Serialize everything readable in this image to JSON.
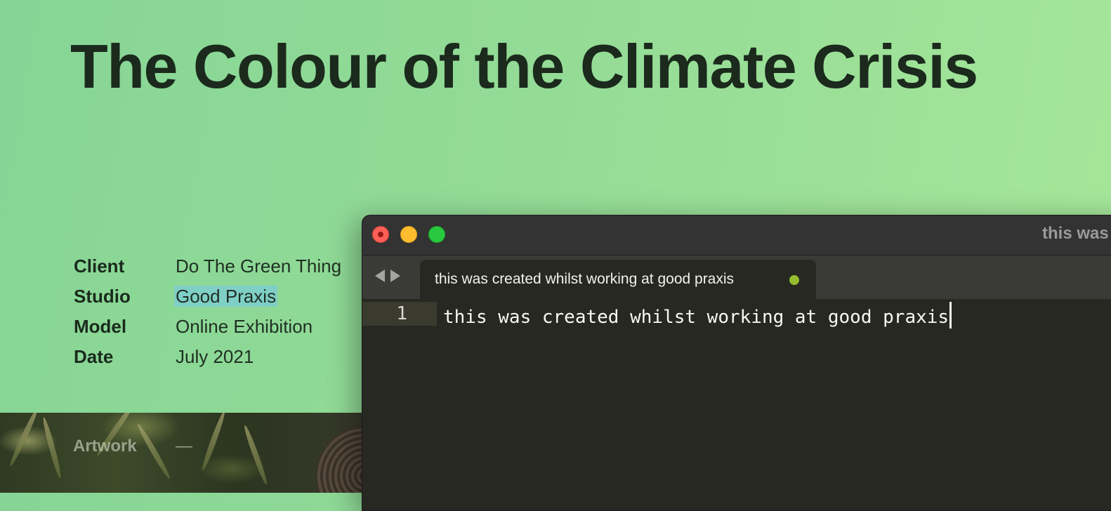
{
  "page": {
    "title": "The Colour of the Climate Crisis",
    "meta": [
      {
        "key": "Client",
        "value": "Do The Green Thing"
      },
      {
        "key": "Studio",
        "value": "Good Praxis"
      },
      {
        "key": "Model",
        "value": "Online Exhibition"
      },
      {
        "key": "Date",
        "value": "July 2021"
      }
    ],
    "artwork_label": "Artwork",
    "artwork_dash": "—"
  },
  "editor": {
    "window_title": "this was created whilst working at good praxis",
    "tab": {
      "label": "this was created whilst working at good praxis",
      "dirty_color": "#96bb2c"
    },
    "lines": [
      {
        "number": "1",
        "text": "this was created whilst working at good praxis"
      }
    ]
  },
  "colors": {
    "background_green": "#93db96",
    "editor_bg": "#272822",
    "highlight": "#7fcfc7"
  },
  "icons": {
    "back": "back-arrow-icon",
    "forward": "forward-arrow-icon"
  }
}
